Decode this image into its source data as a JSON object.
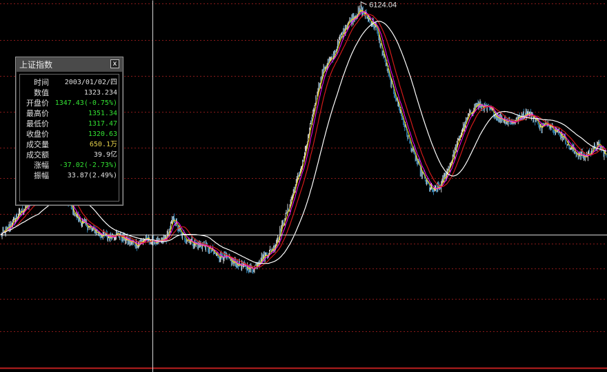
{
  "colors": {
    "background": "#000000",
    "grid": "#8b1a1a",
    "crosshair": "#d8d8d8",
    "up": "#ffffff",
    "down": "#3c9fd9",
    "ma_short": "#ffd400",
    "ma_mid": "#ff00ff",
    "ma_long": "#d21a1a",
    "ma_very_long": "#ffffff",
    "text_default": "#e0e0e0",
    "text_green": "#33e233",
    "text_yellow": "#e6d24b"
  },
  "info_panel": {
    "title": "上证指数",
    "close_label": "x",
    "rows": [
      {
        "label": "时间",
        "value": "2003/01/02/四",
        "color": "#e0e0e0"
      },
      {
        "label": "数值",
        "value": "1323.234",
        "color": "#e0e0e0"
      },
      {
        "label": "开盘价",
        "value": "1347.43(-0.75%)",
        "color": "#33e233"
      },
      {
        "label": "最高价",
        "value": "1351.34",
        "color": "#33e233"
      },
      {
        "label": "最低价",
        "value": "1317.47",
        "color": "#33e233"
      },
      {
        "label": "收盘价",
        "value": "1320.63",
        "color": "#33e233"
      },
      {
        "label": "成交量",
        "value": "650.1万",
        "color": "#e6d24b"
      },
      {
        "label": "成交额",
        "value": "39.9亿",
        "color": "#e0e0e0"
      },
      {
        "label": "涨幅",
        "value": "-37.02(-2.73%)",
        "color": "#33e233"
      },
      {
        "label": "振幅",
        "value": "33.87(2.49%)",
        "color": "#e0e0e0"
      }
    ]
  },
  "chart_data": {
    "type": "line",
    "title": "",
    "xlabel": "",
    "ylabel": "",
    "ylim": [
      700,
      6400
    ],
    "grid": true,
    "peak_label": "6124.04",
    "crosshair_value": 1323.234,
    "series": [
      {
        "values": [
          1320,
          1380,
          1470,
          1560,
          1640,
          1700,
          1730,
          1790,
          1830,
          1720,
          1560,
          1450,
          1410,
          1360,
          1320,
          1300,
          1340,
          1290,
          1260,
          1240,
          1280,
          1270,
          1250,
          1300,
          1480,
          1330,
          1280,
          1240,
          1230,
          1200,
          1150,
          1140,
          1100,
          1080,
          1060,
          1050,
          1120,
          1160,
          1220,
          1400,
          1600,
          1900,
          2200,
          2800,
          3600,
          4200,
          4400,
          5000,
          5600,
          5900,
          6124,
          5800,
          5500,
          4600,
          3800,
          3300,
          2800,
          2400,
          2100,
          1900,
          1780,
          1850,
          2050,
          2350,
          2700,
          3000,
          3230,
          3170,
          3100,
          2950,
          2900,
          2850,
          2950,
          3050,
          2950,
          2750,
          2850,
          2700,
          2600,
          2400,
          2300,
          2250,
          2350,
          2450,
          2250
        ]
      }
    ]
  }
}
